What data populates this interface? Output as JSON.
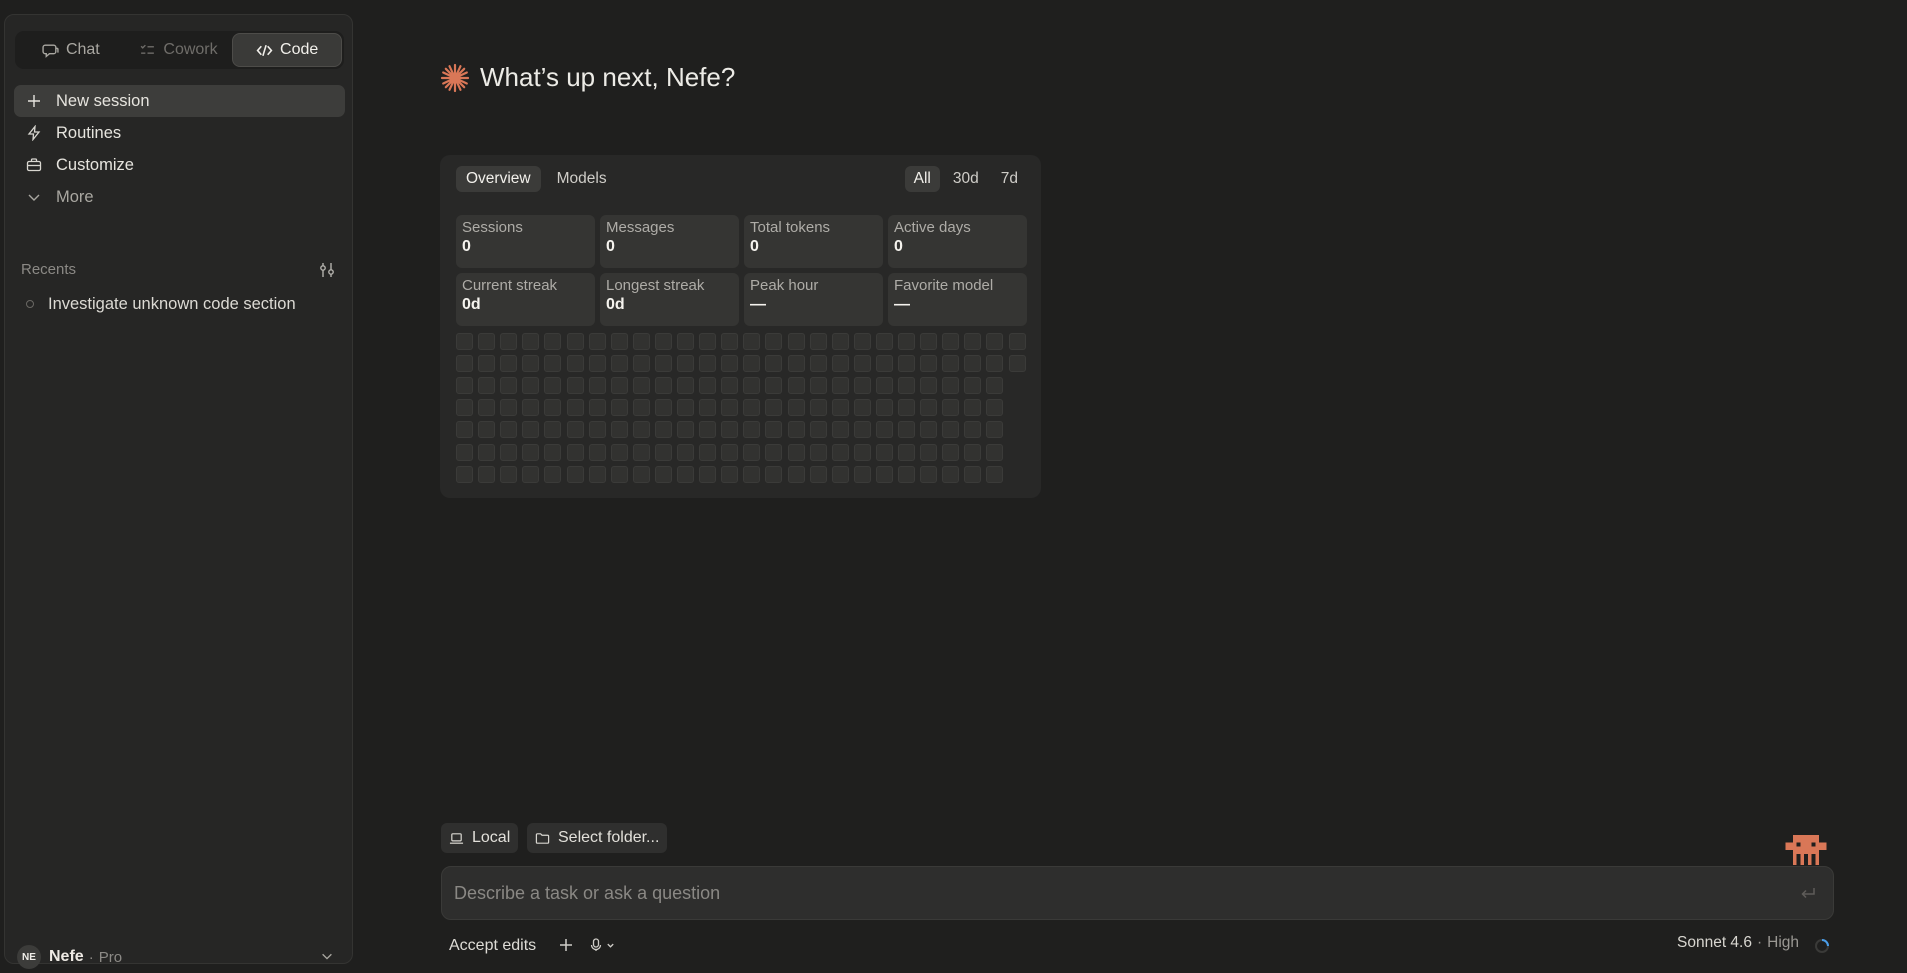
{
  "modes": [
    {
      "label": "Chat",
      "icon": "chat-bubble-icon",
      "state": "normal"
    },
    {
      "label": "Cowork",
      "icon": "checklist-icon",
      "state": "dim"
    },
    {
      "label": "Code",
      "icon": "code-icon",
      "state": "active"
    }
  ],
  "nav": {
    "new_session": "New session",
    "routines": "Routines",
    "customize": "Customize",
    "more": "More"
  },
  "recents": {
    "label": "Recents",
    "items": [
      "Investigate unknown code section"
    ]
  },
  "profile": {
    "initials": "NE",
    "name": "Nefe",
    "separator": "·",
    "plan": "Pro"
  },
  "greeting": "What’s up next, Nefe?",
  "stats": {
    "tabs": [
      "Overview",
      "Models"
    ],
    "ranges": [
      "All",
      "30d",
      "7d"
    ],
    "cards": [
      {
        "label": "Sessions",
        "value": "0"
      },
      {
        "label": "Messages",
        "value": "0"
      },
      {
        "label": "Total tokens",
        "value": "0"
      },
      {
        "label": "Active days",
        "value": "0"
      },
      {
        "label": "Current streak",
        "value": "0d"
      },
      {
        "label": "Longest streak",
        "value": "0d"
      },
      {
        "label": "Peak hour",
        "value": "—"
      },
      {
        "label": "Favorite model",
        "value": "—"
      }
    ]
  },
  "chips": {
    "local": "Local",
    "folder": "Select folder..."
  },
  "prompt": {
    "placeholder": "Describe a task or ask a question"
  },
  "bottom": {
    "accept_edits": "Accept edits",
    "model": "Sonnet 4.6",
    "separator": "·",
    "effort": "High"
  },
  "colors": {
    "accent": "#d97757",
    "background": "#1f1f1e",
    "sidebar": "#262625"
  }
}
